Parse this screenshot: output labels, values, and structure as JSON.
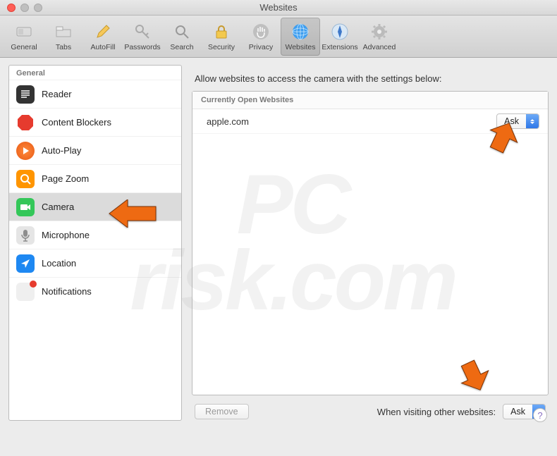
{
  "window": {
    "title": "Websites"
  },
  "toolbar": {
    "items": [
      {
        "id": "general",
        "label": "General"
      },
      {
        "id": "tabs",
        "label": "Tabs"
      },
      {
        "id": "autofill",
        "label": "AutoFill"
      },
      {
        "id": "passwords",
        "label": "Passwords"
      },
      {
        "id": "search",
        "label": "Search"
      },
      {
        "id": "security",
        "label": "Security"
      },
      {
        "id": "privacy",
        "label": "Privacy"
      },
      {
        "id": "websites",
        "label": "Websites",
        "selected": true
      },
      {
        "id": "extensions",
        "label": "Extensions"
      },
      {
        "id": "advanced",
        "label": "Advanced"
      }
    ]
  },
  "sidebar": {
    "header": "General",
    "items": [
      {
        "id": "reader",
        "label": "Reader"
      },
      {
        "id": "contentblockers",
        "label": "Content Blockers"
      },
      {
        "id": "autoplay",
        "label": "Auto-Play"
      },
      {
        "id": "pagezoom",
        "label": "Page Zoom"
      },
      {
        "id": "camera",
        "label": "Camera",
        "selected": true
      },
      {
        "id": "microphone",
        "label": "Microphone"
      },
      {
        "id": "location",
        "label": "Location"
      },
      {
        "id": "notifications",
        "label": "Notifications"
      }
    ]
  },
  "main": {
    "heading": "Allow websites to access the camera with the settings below:",
    "panel_header": "Currently Open Websites",
    "rows": [
      {
        "site": "apple.com",
        "value": "Ask"
      }
    ],
    "footer": {
      "remove_label": "Remove",
      "other_label": "When visiting other websites:",
      "other_value": "Ask"
    }
  },
  "watermark": "PCrisk.com",
  "colors": {
    "accent_blue": "#2f78e8",
    "arrow": "#ee6a12"
  }
}
